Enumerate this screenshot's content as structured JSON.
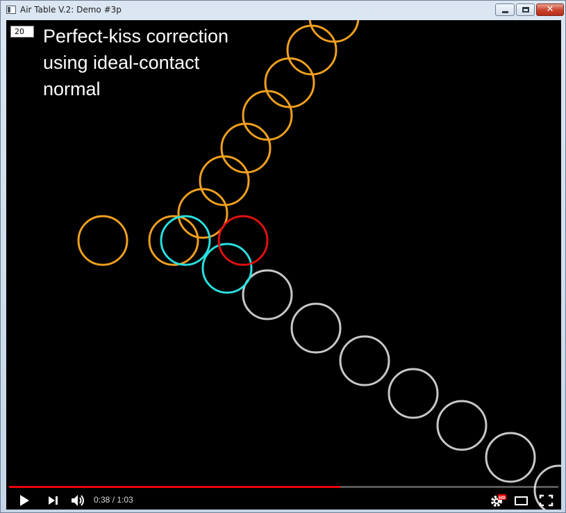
{
  "window": {
    "title": "Air Table V.2: Demo #3p",
    "close_glyph": "✕"
  },
  "overlay": {
    "frame_number": "20",
    "caption_lines": [
      "Perfect-kiss correction",
      "using ideal-contact",
      "normal"
    ]
  },
  "player": {
    "current_time": "0:38",
    "duration": "1:03",
    "time_display": "0:38 / 1:03",
    "progress_fraction": 0.603,
    "quality_badge": "HD",
    "icons": [
      "play-icon",
      "next-icon",
      "volume-icon",
      "settings-icon",
      "theater-mode-icon",
      "fullscreen-icon"
    ]
  },
  "colors": {
    "orange_puck": "#f0a020",
    "cyan_puck": "#29e0e0",
    "red_puck": "#e01010",
    "white_puck": "#c8c8c8",
    "progress": "#ee0000"
  }
}
